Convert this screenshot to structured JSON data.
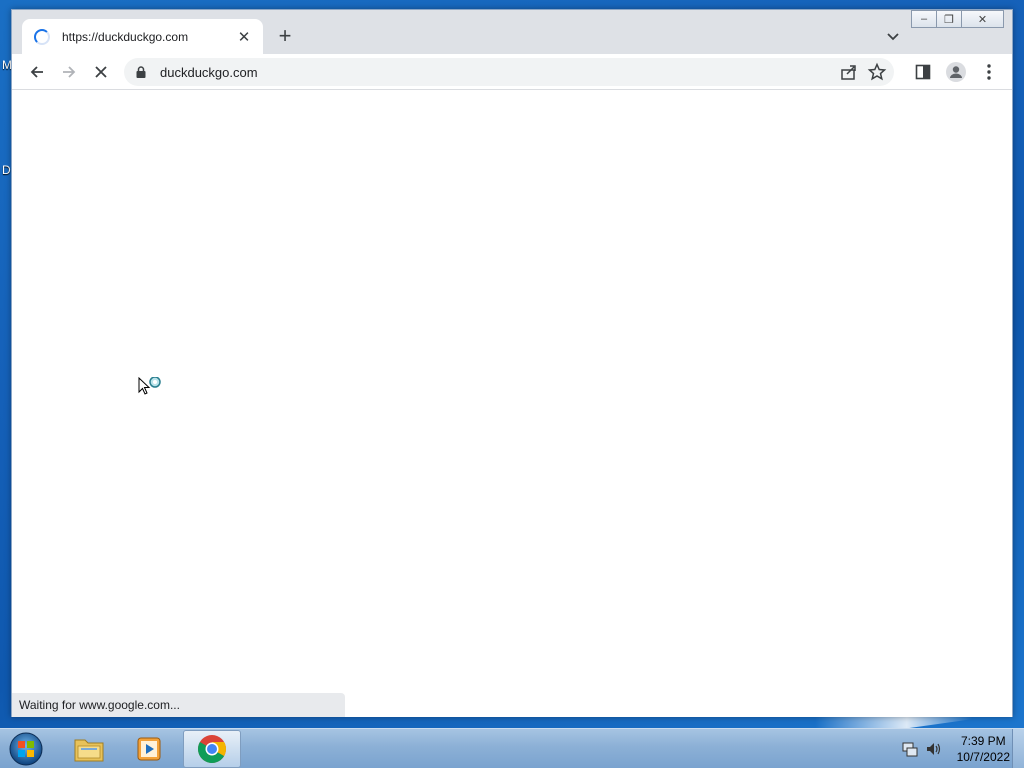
{
  "desktop": {
    "fragment_1": "M",
    "fragment_2": "D"
  },
  "browser": {
    "tab": {
      "title": "https://duckduckgo.com",
      "close_symbol": "✕"
    },
    "new_tab_symbol": "+",
    "address_bar": {
      "url": "duckduckgo.com"
    },
    "status_text": "Waiting for www.google.com..."
  },
  "window_controls": {
    "minimize": "–",
    "restore": "❐",
    "close": "✕"
  },
  "taskbar": {
    "apps": [
      "file-explorer",
      "media-player",
      "chrome"
    ],
    "time": "7:39 PM",
    "date": "10/7/2022"
  },
  "colors": {
    "accent": "#1a73e8",
    "titlebar": "#dee1e6"
  }
}
